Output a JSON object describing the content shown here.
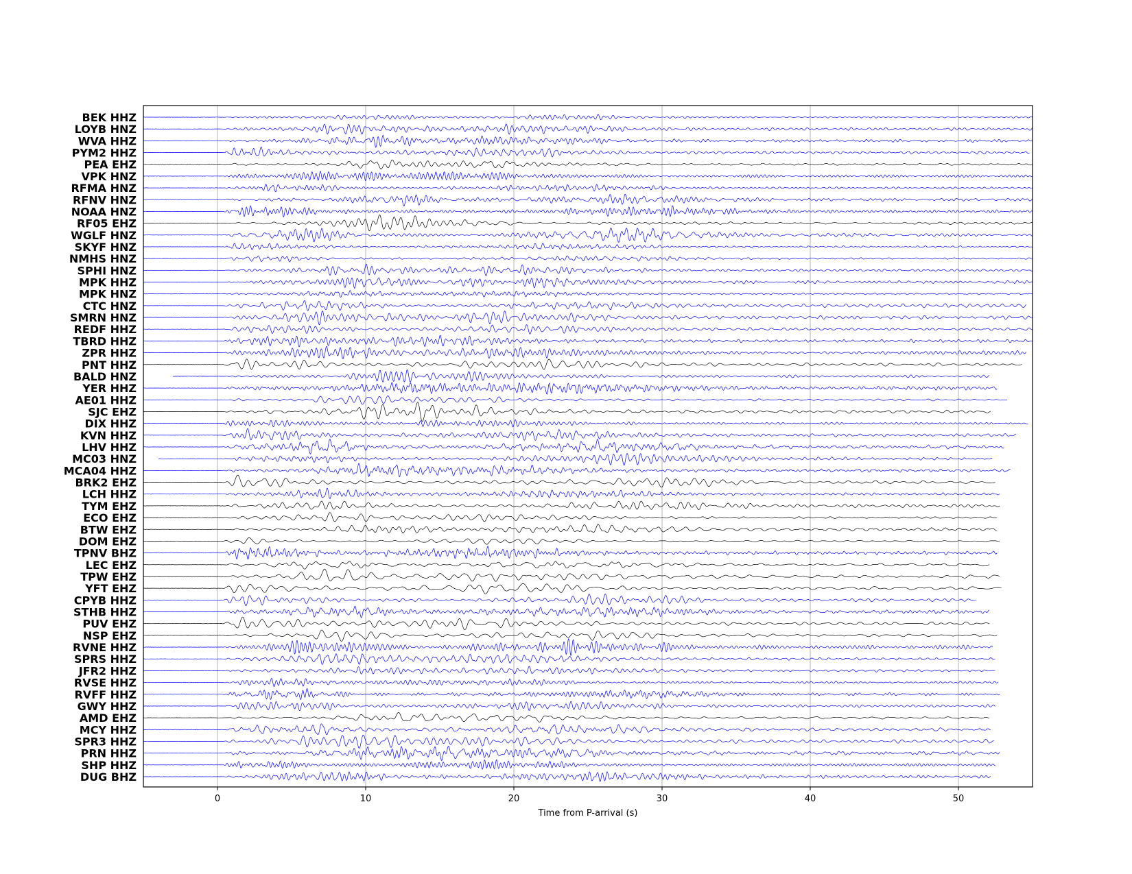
{
  "chart_data": {
    "type": "line",
    "xlabel": "Time from P-arrival (s)",
    "ylabel": "",
    "xlim": [
      -5,
      55
    ],
    "xticks": [
      0,
      10,
      20,
      30,
      40,
      50
    ],
    "grid": "vertical",
    "colors": {
      "HNZ": "#0000ff",
      "HHZ": "#0000ff",
      "BHZ": "#0000ff",
      "EHZ": "#000000"
    },
    "stations": [
      {
        "label": "BEK HHZ",
        "color": "#0000ff",
        "start": -5,
        "end": 55
      },
      {
        "label": "LOYB HNZ",
        "color": "#0000ff",
        "start": -5,
        "end": 55
      },
      {
        "label": "WVA HHZ",
        "color": "#0000ff",
        "start": -5,
        "end": 55
      },
      {
        "label": "PYM2 HHZ",
        "color": "#0000ff",
        "start": -5,
        "end": 54.8
      },
      {
        "label": "PEA EHZ",
        "color": "#000000",
        "start": -5,
        "end": 55
      },
      {
        "label": "VPK HNZ",
        "color": "#0000ff",
        "start": -5,
        "end": 55
      },
      {
        "label": "RFMA HNZ",
        "color": "#0000ff",
        "start": -5,
        "end": 55
      },
      {
        "label": "RFNV HNZ",
        "color": "#0000ff",
        "start": -5,
        "end": 55
      },
      {
        "label": "NOAA HNZ",
        "color": "#0000ff",
        "start": -5,
        "end": 55
      },
      {
        "label": "RF05 EHZ",
        "color": "#000000",
        "start": -5,
        "end": 55
      },
      {
        "label": "WGLF HNZ",
        "color": "#0000ff",
        "start": -5,
        "end": 55
      },
      {
        "label": "SKYF HNZ",
        "color": "#0000ff",
        "start": -5,
        "end": 55
      },
      {
        "label": "NMHS HNZ",
        "color": "#0000ff",
        "start": -5,
        "end": 55
      },
      {
        "label": "SPHI HNZ",
        "color": "#0000ff",
        "start": -5,
        "end": 55
      },
      {
        "label": "MPK HHZ",
        "color": "#0000ff",
        "start": -5,
        "end": 55
      },
      {
        "label": "MPK HNZ",
        "color": "#0000ff",
        "start": -5,
        "end": 55
      },
      {
        "label": "CTC HNZ",
        "color": "#0000ff",
        "start": -5,
        "end": 54.6
      },
      {
        "label": "SMRN HNZ",
        "color": "#0000ff",
        "start": -5,
        "end": 55
      },
      {
        "label": "REDF HHZ",
        "color": "#0000ff",
        "start": -5,
        "end": 55
      },
      {
        "label": "TBRD HHZ",
        "color": "#0000ff",
        "start": -5,
        "end": 55
      },
      {
        "label": "ZPR HHZ",
        "color": "#0000ff",
        "start": -5,
        "end": 54.6
      },
      {
        "label": "PNT HHZ",
        "color": "#000000",
        "start": -5,
        "end": 54.3
      },
      {
        "label": "BALD HNZ",
        "color": "#0000ff",
        "start": -3,
        "end": 52.1
      },
      {
        "label": "YER HHZ",
        "color": "#0000ff",
        "start": -5,
        "end": 52.6
      },
      {
        "label": "AE01 HHZ",
        "color": "#0000ff",
        "start": -5,
        "end": 53.3
      },
      {
        "label": "SJC EHZ",
        "color": "#000000",
        "start": -5,
        "end": 52.2
      },
      {
        "label": "DIX HHZ",
        "color": "#0000ff",
        "start": -5,
        "end": 54.7
      },
      {
        "label": "KVN HHZ",
        "color": "#0000ff",
        "start": -5,
        "end": 53.9
      },
      {
        "label": "LHV HHZ",
        "color": "#0000ff",
        "start": -5,
        "end": 53.1
      },
      {
        "label": "MC03 HNZ",
        "color": "#0000ff",
        "start": -4,
        "end": 52.3
      },
      {
        "label": "MCA04 HHZ",
        "color": "#0000ff",
        "start": -5,
        "end": 53.5
      },
      {
        "label": "BRK2 EHZ",
        "color": "#000000",
        "start": -5,
        "end": 52.5
      },
      {
        "label": "LCH HHZ",
        "color": "#0000ff",
        "start": -5,
        "end": 52.8
      },
      {
        "label": "TYM EHZ",
        "color": "#000000",
        "start": -5,
        "end": 52.8
      },
      {
        "label": "ECO EHZ",
        "color": "#000000",
        "start": -5,
        "end": 52.6
      },
      {
        "label": "BTW EHZ",
        "color": "#000000",
        "start": -5,
        "end": 52.6
      },
      {
        "label": "DOM EHZ",
        "color": "#000000",
        "start": -5,
        "end": 52.8
      },
      {
        "label": "TPNV BHZ",
        "color": "#0000ff",
        "start": -5,
        "end": 52.6
      },
      {
        "label": "LEC EHZ",
        "color": "#000000",
        "start": -5,
        "end": 52.1
      },
      {
        "label": "TPW EHZ",
        "color": "#000000",
        "start": -5,
        "end": 52.8
      },
      {
        "label": "YFT EHZ",
        "color": "#000000",
        "start": -5,
        "end": 52.9
      },
      {
        "label": "CPYB HHZ",
        "color": "#0000ff",
        "start": -5,
        "end": 51.2
      },
      {
        "label": "STHB HHZ",
        "color": "#0000ff",
        "start": -5,
        "end": 52.1
      },
      {
        "label": "PUV EHZ",
        "color": "#000000",
        "start": -5,
        "end": 52.1
      },
      {
        "label": "NSP EHZ",
        "color": "#000000",
        "start": -5,
        "end": 52.6
      },
      {
        "label": "RVNE HHZ",
        "color": "#0000ff",
        "start": -5,
        "end": 52.3
      },
      {
        "label": "SPRS HHZ",
        "color": "#0000ff",
        "start": -5,
        "end": 52.5
      },
      {
        "label": "JFR2 HHZ",
        "color": "#0000ff",
        "start": -5,
        "end": 52.5
      },
      {
        "label": "RVSE HHZ",
        "color": "#0000ff",
        "start": -5,
        "end": 52.7
      },
      {
        "label": "RVFF HHZ",
        "color": "#0000ff",
        "start": -5,
        "end": 52.8
      },
      {
        "label": "GWY HHZ",
        "color": "#0000ff",
        "start": -5,
        "end": 52.5
      },
      {
        "label": "AMD EHZ",
        "color": "#000000",
        "start": -5,
        "end": 52.1
      },
      {
        "label": "MCY HHZ",
        "color": "#0000ff",
        "start": -5,
        "end": 52.2
      },
      {
        "label": "SPR3 HHZ",
        "color": "#0000ff",
        "start": -5,
        "end": 52.4
      },
      {
        "label": "PRN HHZ",
        "color": "#0000ff",
        "start": -5,
        "end": 52.8
      },
      {
        "label": "SHP HHZ",
        "color": "#0000ff",
        "start": -5,
        "end": 52.5
      },
      {
        "label": "DUG BHZ",
        "color": "#0000ff",
        "start": -5,
        "end": 52.2
      }
    ]
  }
}
